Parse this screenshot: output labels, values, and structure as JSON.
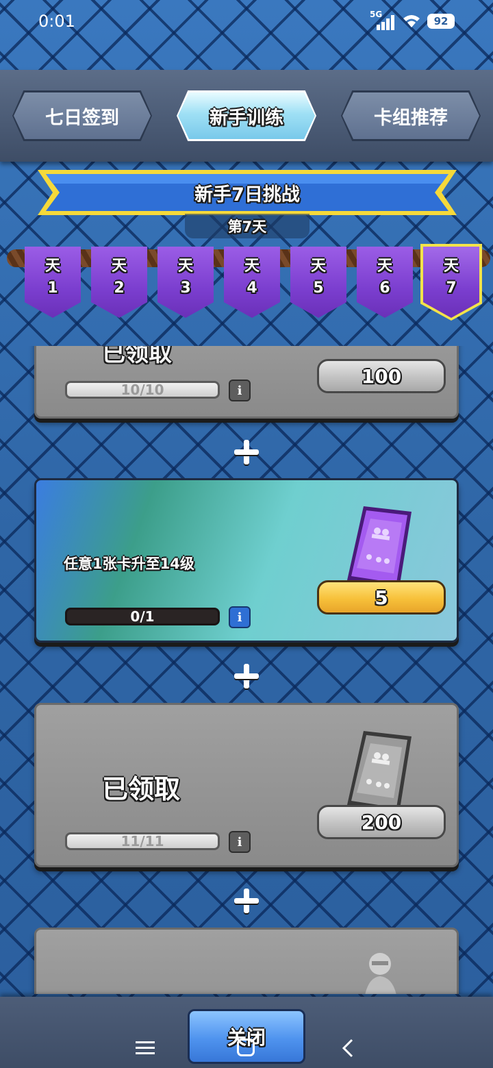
{
  "status_bar": {
    "time": "0:01",
    "network": "5G",
    "battery": "92"
  },
  "tabs": [
    {
      "label": "七日签到",
      "active": false
    },
    {
      "label": "新手训练",
      "active": true
    },
    {
      "label": "卡组推荐",
      "active": false
    }
  ],
  "challenge": {
    "title": "新手7日挑战",
    "current_day": "第7天"
  },
  "days": [
    {
      "label": "天",
      "number": "1"
    },
    {
      "label": "天",
      "number": "2"
    },
    {
      "label": "天",
      "number": "3"
    },
    {
      "label": "天",
      "number": "4"
    },
    {
      "label": "天",
      "number": "5"
    },
    {
      "label": "天",
      "number": "6"
    },
    {
      "label": "天",
      "number": "7",
      "selected": true
    }
  ],
  "tasks": [
    {
      "progress": "10/10",
      "reward": "100",
      "state": "claimed",
      "partial_text": "已领取"
    },
    {
      "description": "任意1张卡升至14级",
      "progress": "0/1",
      "reward": "5",
      "state": "active"
    },
    {
      "status_text": "已领取",
      "progress": "11/11",
      "reward": "200",
      "state": "claimed"
    }
  ],
  "close_button": "关闭",
  "colors": {
    "accent_gold": "#f7c13a",
    "active_tab": "#9fe0f5",
    "flag_purple": "#7b3ecf"
  },
  "icons": [
    "signal-icon",
    "wifi-icon",
    "info-icon",
    "card-reward-icon",
    "plus-icon",
    "menu-icon",
    "home-icon",
    "back-icon"
  ]
}
